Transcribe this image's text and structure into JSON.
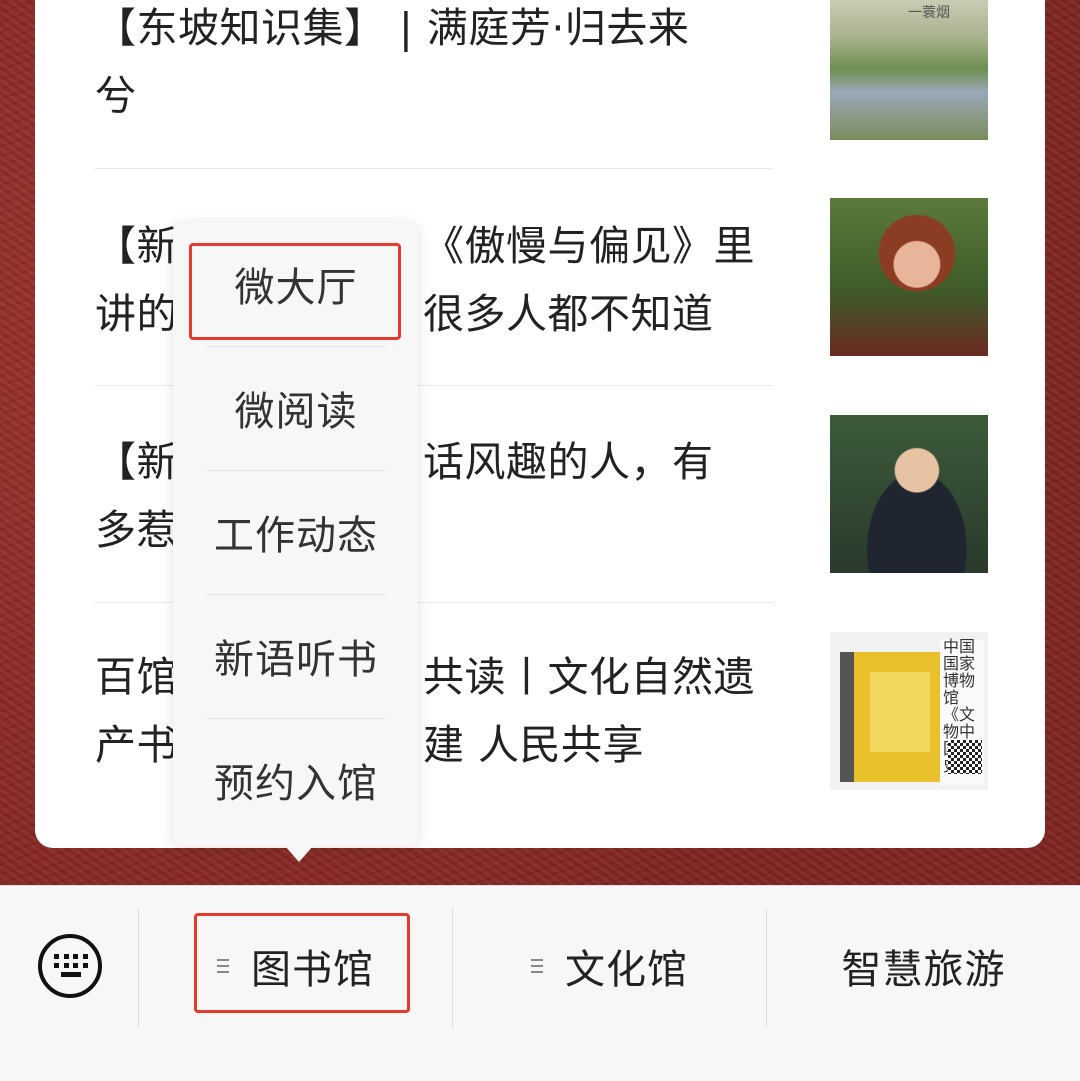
{
  "articles": [
    {
      "title": "【东坡知识集】 | 满庭芳·归去来兮",
      "thumbnail": "river-landscape-painting",
      "thumbnail_caption": "一蓑烟"
    },
    {
      "title": "【新语读书会】《傲慢与偏见》里讲的道理，很多人都不知道",
      "thumbnail": "woman-portrait"
    },
    {
      "title": "【新语读书会】说话风趣的人，有多惹人爱",
      "thumbnail": "man-with-glasses-portrait"
    },
    {
      "title": "百馆联动 好书共读丨文化自然遗产书香溢满 共建 人民共享",
      "thumbnail": "book-box-cover",
      "thumbnail_text": "中国国家博物馆《文物中国史》"
    }
  ],
  "visible_lines": [
    [
      "【东坡知识集】 | 满庭芳·归去来",
      "兮"
    ],
    [
      "【新",
      "讲的",
      "《傲慢与偏见》里",
      "很多人都不知道"
    ],
    [
      "【新",
      "多惹",
      "话风趣的人，有"
    ],
    [
      "百馆",
      "产书",
      "共读丨文化自然遗",
      "建 人民共享"
    ]
  ],
  "popup_menu": {
    "items": [
      "微大厅",
      "微阅读",
      "工作动态",
      "新语听书",
      "预约入馆"
    ],
    "highlighted_item": "微大厅"
  },
  "bottom_bar": {
    "keyboard_icon": "keyboard-toggle-icon",
    "tabs": [
      {
        "label": "图书馆",
        "has_menu_icon": true,
        "highlighted": true
      },
      {
        "label": "文化馆",
        "has_menu_icon": true,
        "highlighted": false
      },
      {
        "label": "智慧旅游",
        "has_menu_icon": false,
        "highlighted": false
      }
    ]
  },
  "colors": {
    "background": "#8a2a26",
    "highlight": "#e53a2e",
    "card": "#ffffff",
    "popup": "#f7f7f7"
  }
}
